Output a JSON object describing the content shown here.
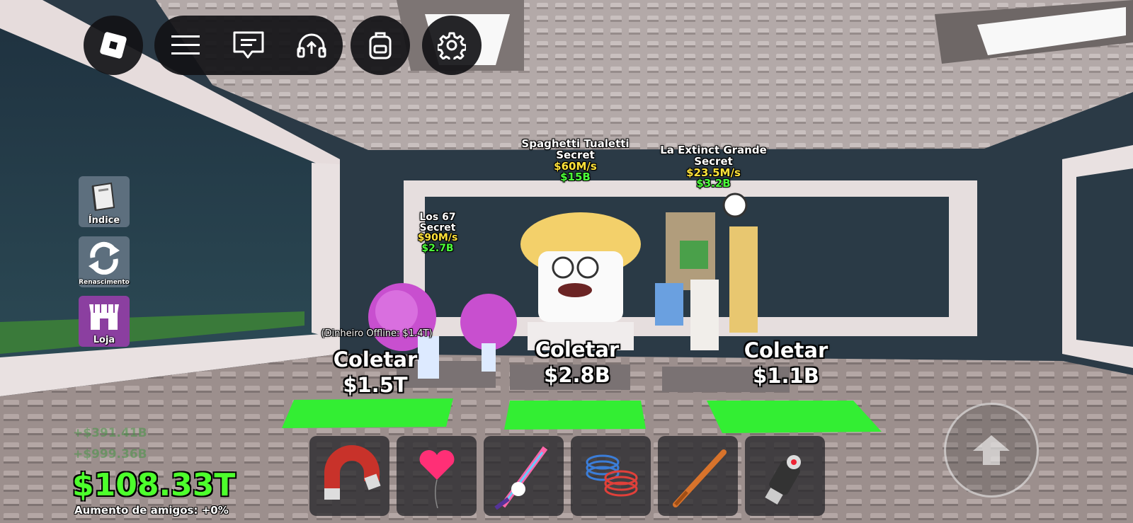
{
  "hud": {
    "menu_buttons": [
      "roblox-logo",
      "menu",
      "chat",
      "voice",
      "backpack",
      "settings"
    ]
  },
  "sidebar": {
    "items": [
      {
        "label": "Índice",
        "icon": "book-icon"
      },
      {
        "label": "Renascimento",
        "icon": "rebirth-arrows-icon"
      },
      {
        "label": "Loja",
        "icon": "store-icon"
      }
    ]
  },
  "brainrots": [
    {
      "name": "Los 67",
      "rarity": "Secret",
      "rate": "$90M/s",
      "price": "$2.7B"
    },
    {
      "name": "Spaghetti Tualetti",
      "rarity": "Secret",
      "rate": "$60M/s",
      "price": "$15B"
    },
    {
      "name": "La Extinct Grande",
      "rarity": "Secret",
      "rate": "$23.5M/s",
      "price": "$3.2B"
    }
  ],
  "collectors": [
    {
      "label": "Coletar",
      "amount": "$1.5T",
      "offline": "(Dinheiro Offline: $1.4T)"
    },
    {
      "label": "Coletar",
      "amount": "$2.8B"
    },
    {
      "label": "Coletar",
      "amount": "$1.1B"
    }
  ],
  "hotbar": {
    "slots": [
      "magnet-icon",
      "heart-balloon-icon",
      "unicorn-sword-icon",
      "spring-coils-icon",
      "baseball-bat-icon",
      "grapple-gun-icon"
    ]
  },
  "stats": {
    "money": "$108.33T",
    "recent_gains": [
      "+$391.41B",
      "+$999.36B"
    ],
    "friend_boost": "Aumento de amigos: +0%"
  },
  "colors": {
    "money": "#4dff2c",
    "rate": "#ffe23a",
    "price": "#4cff3a",
    "pad": "#33ee33"
  }
}
